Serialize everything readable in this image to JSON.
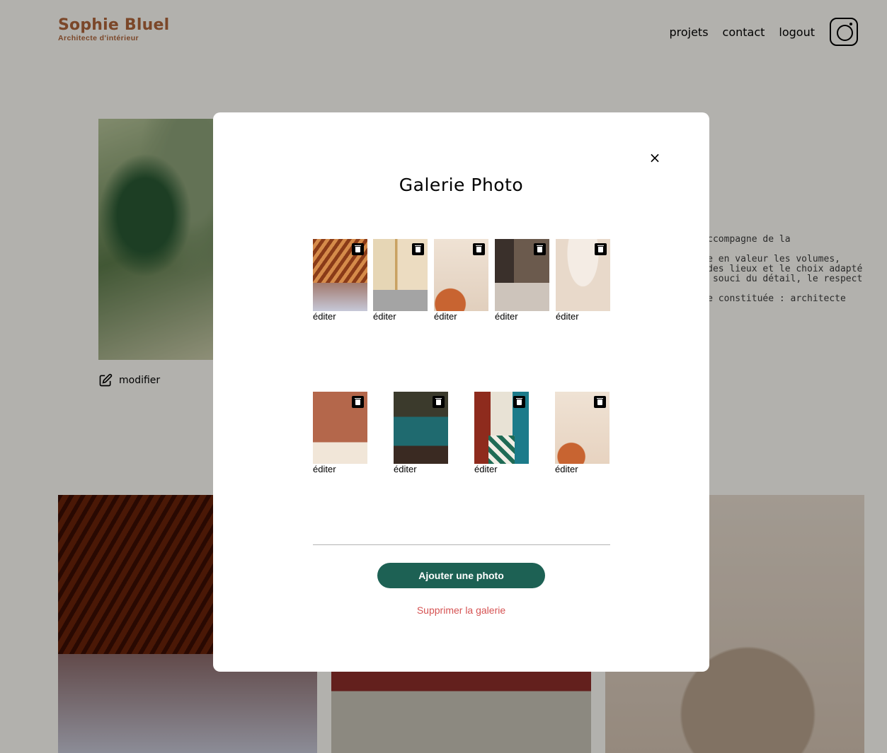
{
  "header": {
    "logo_name": "Sophie Bluel",
    "logo_subtitle": "Architecte d'intérieur",
    "nav": [
      "projets",
      "contact",
      "logout"
    ],
    "instagram_icon": "instagram-icon"
  },
  "intro": {
    "modify_label": "modifier",
    "about_fragments": [
      "ous accompagne de la",
      "mettre en valeur les volumes,",
      "prit des lieux et le choix adapté",
      "ns le souci du détail, le respect",
      "t-être constituée : architecte"
    ]
  },
  "modal": {
    "title": "Galerie Photo",
    "close_label": "×",
    "edit_label": "éditer",
    "thumbnails": [
      {
        "edit": "éditer"
      },
      {
        "edit": "éditer"
      },
      {
        "edit": "éditer"
      },
      {
        "edit": "éditer"
      },
      {
        "edit": "éditer"
      },
      {
        "edit": "éditer"
      },
      {
        "edit": "éditer"
      },
      {
        "edit": "éditer"
      },
      {
        "edit": "éditer"
      }
    ],
    "add_button": "Ajouter une photo",
    "delete_gallery": "Supprimer la galerie"
  },
  "colors": {
    "brand": "#b1663c",
    "button": "#1d6154",
    "delete": "#d65353",
    "overlay": "rgba(0,0,0,0.30)"
  }
}
